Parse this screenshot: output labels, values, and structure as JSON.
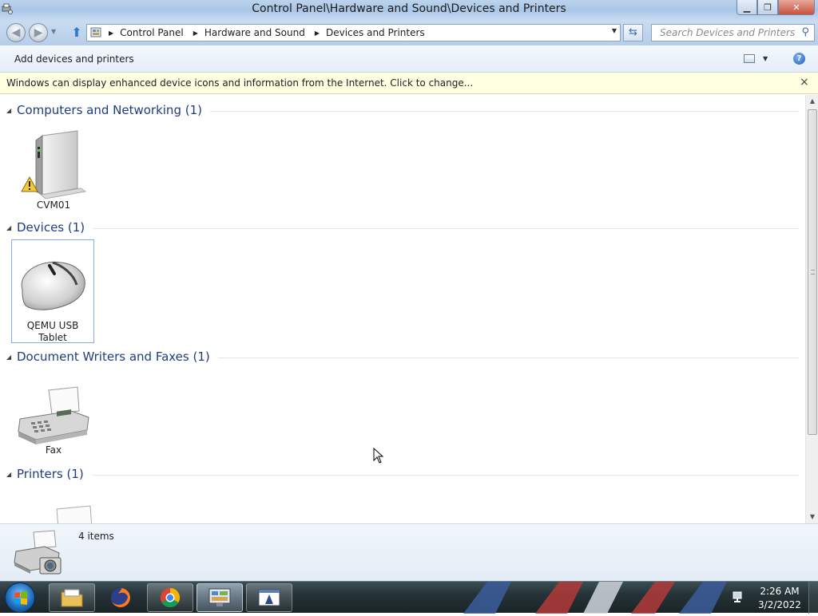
{
  "window": {
    "title": "Control Panel\\Hardware and Sound\\Devices and Printers",
    "icon": "devices-printers-icon",
    "buttons": {
      "minimize": "minimize-icon",
      "restore": "restore-icon",
      "close": "close-icon"
    }
  },
  "address": {
    "crumbs": [
      "Control Panel",
      "Hardware and Sound",
      "Devices and Printers"
    ],
    "search_placeholder": "Search Devices and Printers"
  },
  "toolbar": {
    "add_label": "Add devices and printers",
    "help_glyph": "?"
  },
  "infobar": {
    "message": "Windows can display enhanced device icons and information from the Internet. Click to change...",
    "close_glyph": "×"
  },
  "groups": [
    {
      "title": "Computers and Networking (1)",
      "items": [
        {
          "label": "CVM01",
          "icon": "computer-tower-icon",
          "badge": "warning-icon"
        }
      ]
    },
    {
      "title": "Devices (1)",
      "items": [
        {
          "label": "QEMU USB Tablet",
          "icon": "mouse-icon",
          "selected": true
        }
      ]
    },
    {
      "title": "Document Writers and Faxes (1)",
      "items": [
        {
          "label": "Fax",
          "icon": "fax-icon"
        }
      ]
    },
    {
      "title": "Printers (1)",
      "items": [
        {
          "label": "",
          "icon": "printer-icon"
        }
      ]
    }
  ],
  "details": {
    "count": "4 items",
    "icon": "printer-camera-icon"
  },
  "taskbar": {
    "apps": [
      "file-explorer-icon",
      "firefox-icon",
      "chrome-icon",
      "control-panel-icon",
      "device-window-icon"
    ],
    "time": "2:26 AM",
    "date": "3/2/2022"
  },
  "colors": {
    "group_title": "#1e3d80",
    "infobar_bg": "#ffffe1",
    "selection_border": "#84acdd"
  }
}
